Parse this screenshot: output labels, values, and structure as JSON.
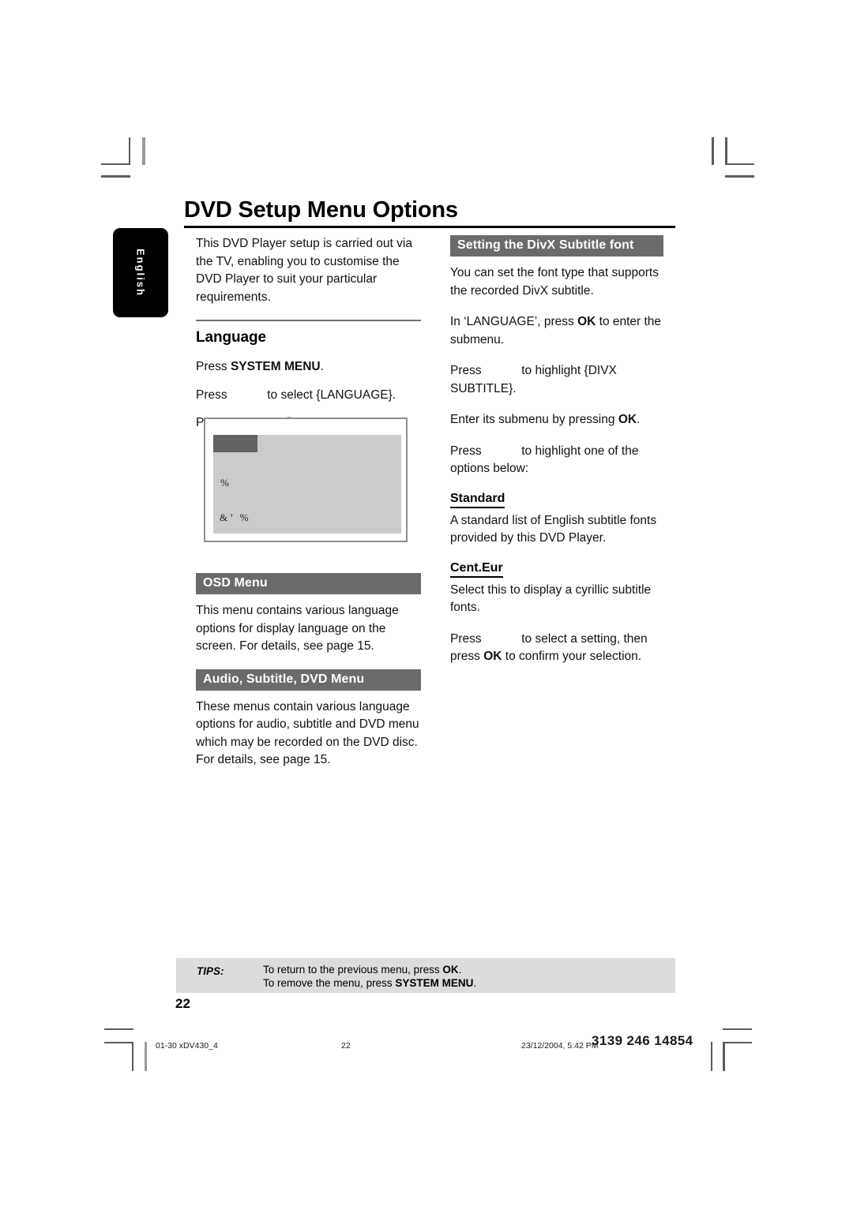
{
  "document": {
    "title": "DVD Setup Menu Options",
    "side_tab": "English",
    "page_number": "22"
  },
  "left_column": {
    "intro": "This DVD Player setup is carried out via the TV, enabling you to customise the DVD Player to suit your particular requirements.",
    "language_heading": "Language",
    "steps": [
      {
        "pre": "Press ",
        "strong": "SYSTEM MENU",
        "post": "."
      },
      {
        "pre": "Press ",
        "keyslot": true,
        "post": " to select {LANGUAGE}."
      },
      {
        "pre": "Press ",
        "strong": "OK",
        "post": " to confirm."
      }
    ],
    "screenshot": {
      "glyph_1": "%",
      "glyph_2": "&’ %"
    },
    "osd_menu": {
      "bar_label": "OSD Menu",
      "body": "This menu contains various language options for display language on the screen. For details, see page 15."
    },
    "audio_subtitle_dvd_menu": {
      "bar_label": "Audio, Subtitle, DVD Menu",
      "body": "These menus contain various language options for audio, subtitle and DVD menu which may be recorded on the DVD disc. For details, see page 15."
    }
  },
  "right_column": {
    "bar_label": "Setting the DivX Subtitle font",
    "p1": "You can set the font type that supports the recorded DivX subtitle.",
    "p2_pre": "In ‘LANGUAGE’, press ",
    "p2_strong": "OK",
    "p2_post": " to enter the submenu.",
    "p3_pre": "Press ",
    "p3_post": " to highlight {DIVX SUBTITLE}.",
    "p4_pre": "Enter its submenu by pressing ",
    "p4_strong": "OK",
    "p4_post": ".",
    "p5_pre": "Press ",
    "p5_post": " to highlight one of the options below:",
    "standard": {
      "heading": "Standard",
      "body": "A standard list of English subtitle fonts provided by this DVD Player."
    },
    "cent_eur": {
      "heading": "Cent.Eur",
      "body": "Select this to display a cyrillic subtitle fonts."
    },
    "p6_pre": "Press ",
    "p6_mid": " to select a setting, then press ",
    "p6_strong": "OK",
    "p6_post": " to confirm your selection."
  },
  "tips": {
    "label": "TIPS:",
    "line1_pre": "To return to the previous menu, press ",
    "line1_strong": "OK",
    "line1_post": ".",
    "line2_pre": "To remove the menu, press ",
    "line2_strong": "SYSTEM MENU",
    "line2_post": "."
  },
  "footer": {
    "file": "01-30 xDV430_4",
    "page": "22",
    "timestamp": "23/12/2004, 5:42 PM",
    "doc_code": "3139 246 14854"
  },
  "colors": {
    "bar_gray": "#6b6b6b",
    "tips_gray": "#dcdcdc",
    "screenshot_panel": "#cbcbcb",
    "screenshot_header": "#636363",
    "tab_black": "#000000"
  }
}
